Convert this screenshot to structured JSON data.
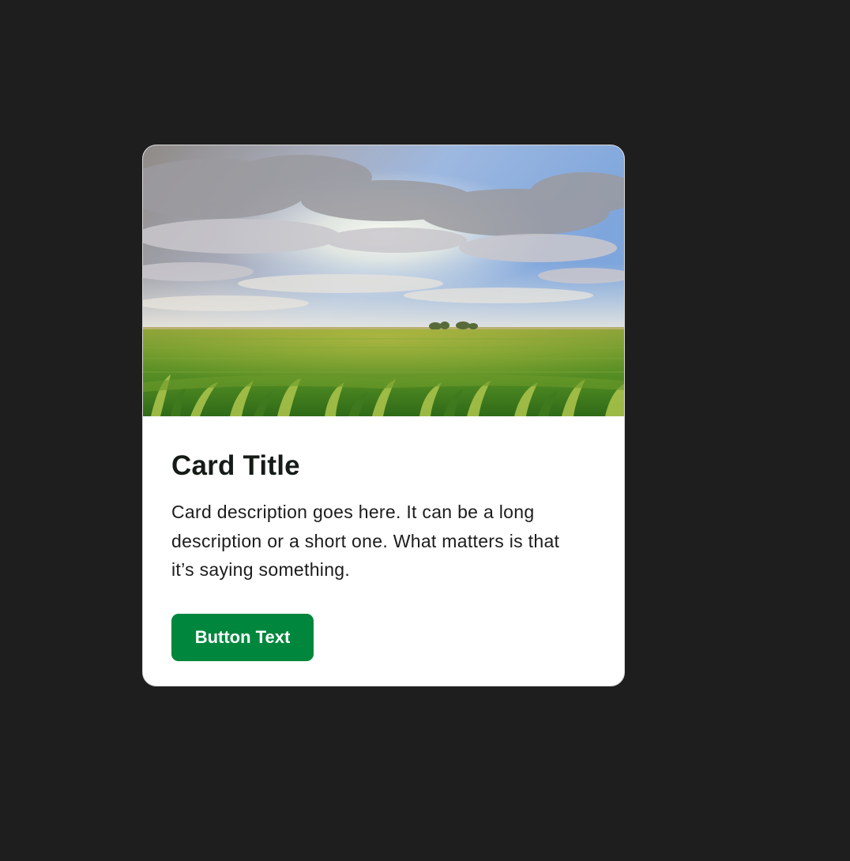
{
  "card": {
    "image_alt": "Green corn field under a cloudy blue sky",
    "title": "Card Title",
    "description": "Card description goes here. It can be a long description or a short one. What matters is that it’s saying something.",
    "button_label": "Button Text"
  },
  "colors": {
    "page_background": "#1e1e1e",
    "card_background": "#ffffff",
    "button_background": "#00873d",
    "button_text": "#ffffff",
    "title_text": "#151b17"
  }
}
